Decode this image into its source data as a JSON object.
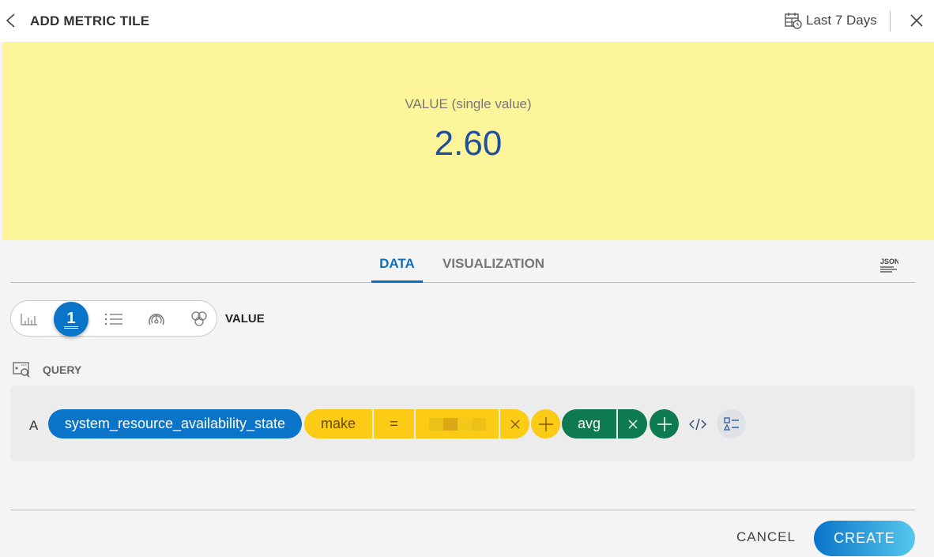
{
  "header": {
    "title": "ADD METRIC TILE",
    "date_range": "Last 7 Days"
  },
  "preview": {
    "label": "VALUE (single value)",
    "value": "2.60",
    "background": "#fdf59a",
    "value_color": "#1f4e9e"
  },
  "tabs": [
    {
      "label": "DATA",
      "active": true
    },
    {
      "label": "VISUALIZATION",
      "active": false
    }
  ],
  "json_button": "JSON",
  "visualization": {
    "types": [
      "bar-chart",
      "single-value",
      "list",
      "gauge",
      "honeycomb"
    ],
    "active_index": 1,
    "active_glyph": "1",
    "selected_label": "VALUE"
  },
  "query": {
    "section_label": "QUERY",
    "letter": "A",
    "metric": "system_resource_availability_state",
    "filter": {
      "key": "make",
      "operator": "=",
      "value": ""
    },
    "aggregation": "avg"
  },
  "footer": {
    "cancel_label": "CANCEL",
    "create_label": "CREATE"
  },
  "colors": {
    "accent": "#0a74c9",
    "filter_chip": "#fbcb16",
    "aggregation_chip": "#0e7a4f"
  }
}
